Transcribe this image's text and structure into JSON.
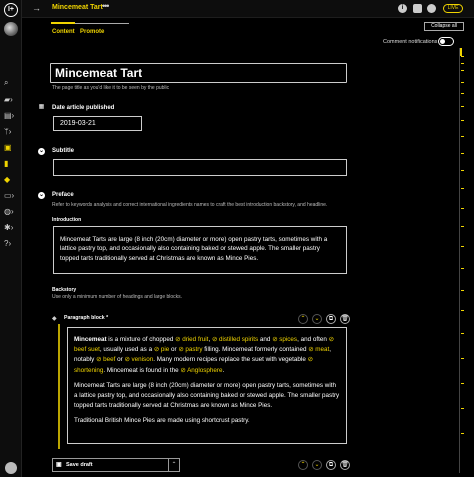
{
  "app": {
    "logo_text": "I+",
    "window_title": "Mincemeat Tart",
    "live_badge": "LIVE",
    "accent_color": "#f0d400"
  },
  "topbar": {
    "back_label": "→",
    "menu_label": "•••",
    "icons": [
      "info-icon",
      "comment-icon",
      "bell-icon"
    ]
  },
  "tabs": [
    {
      "label": "Content"
    },
    {
      "label": "Promote"
    }
  ],
  "toolbar": {
    "collapse_all": "Collapse all",
    "comment_notifications": "Comment notifications"
  },
  "fields": {
    "title": {
      "value": "Mincemeat Tart",
      "hint": "The page title as you'd like it to be seen by the public"
    },
    "date": {
      "label": "Date article published",
      "value": "2019-03-21"
    },
    "subtitle": {
      "label": "Subtitle",
      "value": ""
    },
    "preface": {
      "label": "Preface",
      "hint": "Refer to keywords analysis and correct international ingredients names to craft the best introduction backstory, and headline."
    },
    "introduction": {
      "label": "Introduction",
      "value": "Mincemeat Tarts are large (8 inch (20cm) diameter or more) open pastry tarts, sometimes with a lattice pastry top, and occasionally also containing baked or stewed apple. The smaller pastry topped tarts traditionally served at Christmas are known as Mince Pies."
    },
    "backstory": {
      "label": "Backstory",
      "hint": "Use only a minimum number of headings and large blocks."
    }
  },
  "paragraph_block": {
    "label": "Paragraph block",
    "required_mark": "*",
    "p1": {
      "bold": "Mincemeat",
      "t1": " is a mixture of chopped ",
      "l1": "dried fruit",
      "t2": ", ",
      "l2": "distilled spirits",
      "t3": " and ",
      "l3": "spices",
      "t4": ", and often ",
      "l4": "beef suet",
      "t5": ", usually used as a ",
      "l5": "pie",
      "t6": " or ",
      "l6": "pastry",
      "t7": " filling. Mincemeat formerly contained ",
      "l7": "meat",
      "t8": ", notably ",
      "l8": "beef",
      "t9": " or ",
      "l9": "venison",
      "t10": ". Many modern recipes replace the suet with vegetable ",
      "l10": "shortening",
      "t11": ". Mincemeat is found in the ",
      "l11": "Anglosphere",
      "t12": "."
    },
    "p2": "Mincemeat Tarts are large (8 inch (20cm) diameter or more) open pastry tarts, sometimes with a lattice pastry top, and occasionally also containing baked or stewed apple. The smaller pastry topped tarts traditionally served at Christmas are known as Mince Pies.",
    "p3": "Traditional British Mince Pies are made using shortcrust pastry.",
    "link_icon": "⊘"
  },
  "footer": {
    "save_draft": "Save draft"
  }
}
